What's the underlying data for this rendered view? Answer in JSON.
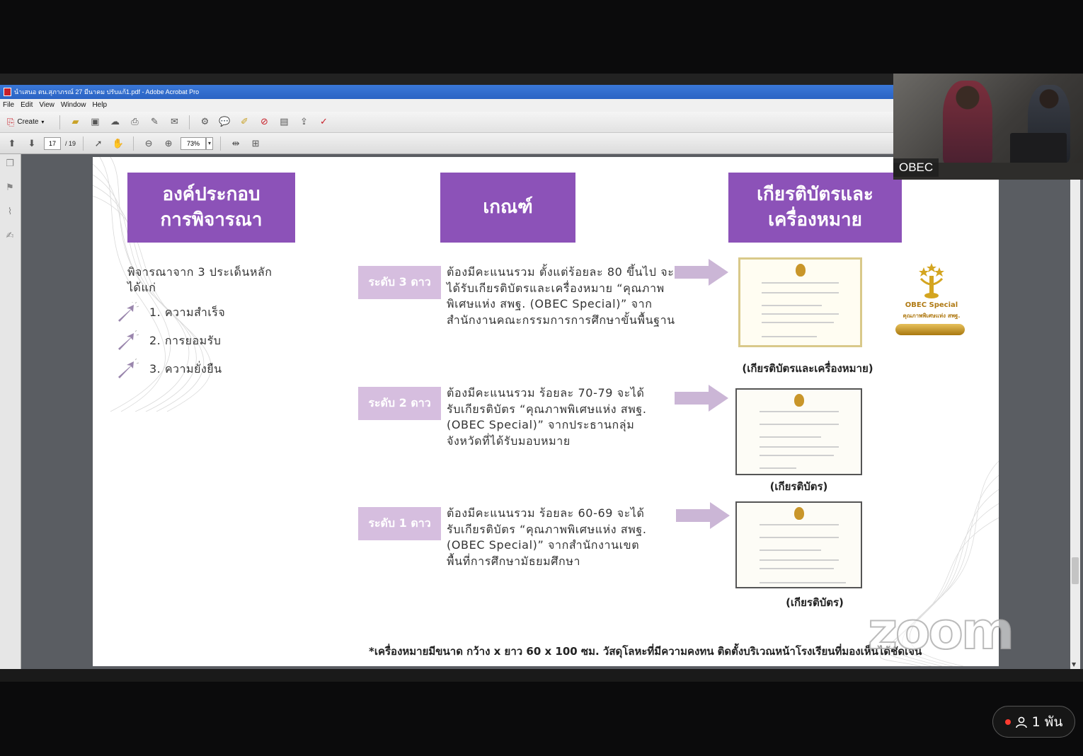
{
  "window": {
    "title": "นำเสนอ ตน.สุภาภรณ์ 27 มีนาคม ปรับแก้1.pdf - Adobe Acrobat Pro"
  },
  "menu": [
    "File",
    "Edit",
    "View",
    "Window",
    "Help"
  ],
  "toolbar": {
    "create_label": "Create",
    "current_page": "17",
    "total_pages": "/ 19",
    "zoom_level": "73%"
  },
  "slide": {
    "headers": {
      "components": "องค์ประกอบ\nการพิจารณา",
      "criteria": "เกณฑ์",
      "awards": "เกียรติบัตรและ\nเครื่องหมาย"
    },
    "intro": "พิจารณาจาก 3 ประเด็นหลัก ได้แก่",
    "points": [
      "1. ความสำเร็จ",
      "2. การยอมรับ",
      "3. ความยั่งยืน"
    ],
    "levels": [
      {
        "label": "ระดับ 3 ดาว",
        "criteria": "ต้องมีคะแนนรวม ตั้งแต่ร้อยละ 80 ขึ้นไป จะได้รับเกียรติบัตรและเครื่องหมาย “คุณภาพพิเศษแห่ง สพฐ. (OBEC Special)” จากสำนักงานคณะกรรมการการศึกษาขั้นพื้นฐาน",
        "caption": "(เกียรติบัตรและเครื่องหมาย)"
      },
      {
        "label": "ระดับ 2 ดาว",
        "criteria": "ต้องมีคะแนนรวม ร้อยละ 70-79 จะได้รับเกียรติบัตร “คุณภาพพิเศษแห่ง สพฐ. (OBEC Special)” จากประธานกลุ่มจังหวัดที่ได้รับมอบหมาย",
        "caption": "(เกียรติบัตร)"
      },
      {
        "label": "ระดับ 1 ดาว",
        "criteria": "ต้องมีคะแนนรวม ร้อยละ 60-69 จะได้รับเกียรติบัตร “คุณภาพพิเศษแห่ง สพฐ. (OBEC Special)” จากสำนักงานเขตพื้นที่การศึกษามัธยมศึกษา",
        "caption": "(เกียรติบัตร)"
      }
    ],
    "emblem_title": "OBEC Special",
    "emblem_subtitle": "คุณภาพพิเศษแห่ง สพฐ.",
    "footnote": "*เครื่องหมายมีขนาด กว้าง x ยาว 60 x 100 ซม. วัสดุโลหะที่มีความคงทน ติดตั้งบริเวณหน้าโรงเรียนที่มองเห็นได้ชัดเจน"
  },
  "zoom": {
    "watermark": "zoom",
    "participant_name": "OBEC",
    "viewers": "1 พัน"
  }
}
